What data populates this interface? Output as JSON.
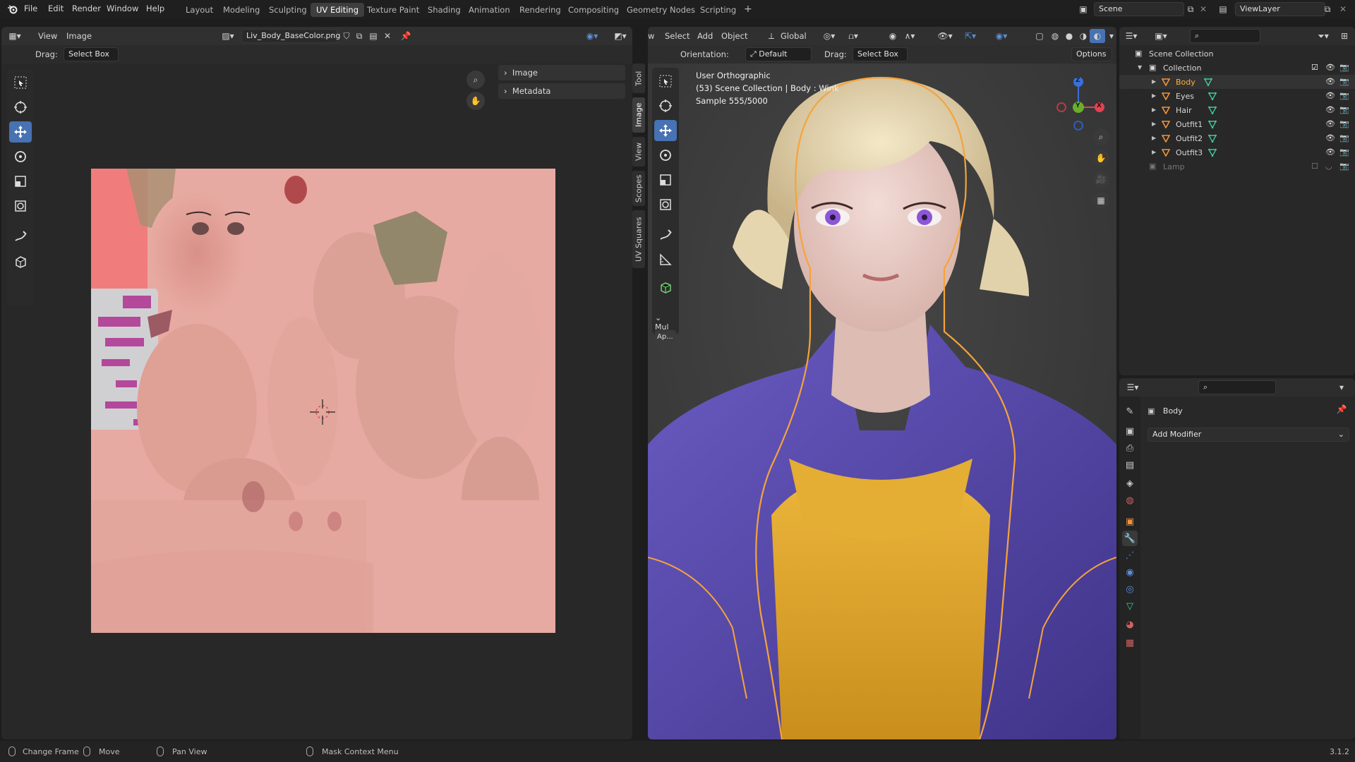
{
  "topbar": {
    "menus": [
      "File",
      "Edit",
      "Render",
      "Window",
      "Help"
    ],
    "workspaces": [
      "Layout",
      "Modeling",
      "Sculpting",
      "UV Editing",
      "Texture Paint",
      "Shading",
      "Animation",
      "Rendering",
      "Compositing",
      "Geometry Nodes",
      "Scripting"
    ],
    "active_workspace": "UV Editing",
    "add_tab_glyph": "+",
    "scene": "Scene",
    "view_layer": "ViewLayer"
  },
  "uv_editor": {
    "menus": [
      "View",
      "Image"
    ],
    "image_name": "Liv_Body_BaseColor.png",
    "drag_label": "Drag:",
    "drag_value": "Select Box",
    "sidebar_panels": [
      "Image",
      "Metadata"
    ],
    "side_tabs": [
      "Tool",
      "Image",
      "View",
      "Scopes",
      "UV Squares"
    ],
    "active_side_tab": "Image"
  },
  "viewport": {
    "menu_cut": "w",
    "menus": [
      "Select",
      "Add",
      "Object"
    ],
    "transform_space": "Global",
    "orientation_label": "Orientation:",
    "orientation_value": "Default",
    "drag_label": "Drag:",
    "drag_value": "Select Box",
    "options_label": "Options",
    "overlay_line1": "User Orthographic",
    "overlay_line2": "(53) Scene Collection | Body : Wink",
    "overlay_line3": "Sample 555/5000",
    "redo_panel_title": "Mul",
    "redo_panel_button": "Ap...",
    "gizmo_axes": [
      "Z",
      "Y",
      "X"
    ]
  },
  "outliner": {
    "root": "Scene Collection",
    "collection": "Collection",
    "objects": [
      {
        "name": "Body",
        "selected": true
      },
      {
        "name": "Eyes",
        "selected": false
      },
      {
        "name": "Hair",
        "selected": false
      },
      {
        "name": "Outfit1",
        "selected": false
      },
      {
        "name": "Outfit2",
        "selected": false
      },
      {
        "name": "Outfit3",
        "selected": false
      }
    ],
    "excluded": "Lamp"
  },
  "properties": {
    "object_name": "Body",
    "add_modifier": "Add Modifier"
  },
  "status": {
    "items": [
      "Change Frame",
      "Move",
      "Pan View",
      "Mask Context Menu"
    ],
    "version": "3.1.2"
  },
  "colors": {
    "accent": "#4772b3",
    "selected_text": "#ffae3a",
    "outline": "#f5a33b",
    "jacket": "#5a4aa8",
    "shirt": "#e8b02c"
  }
}
